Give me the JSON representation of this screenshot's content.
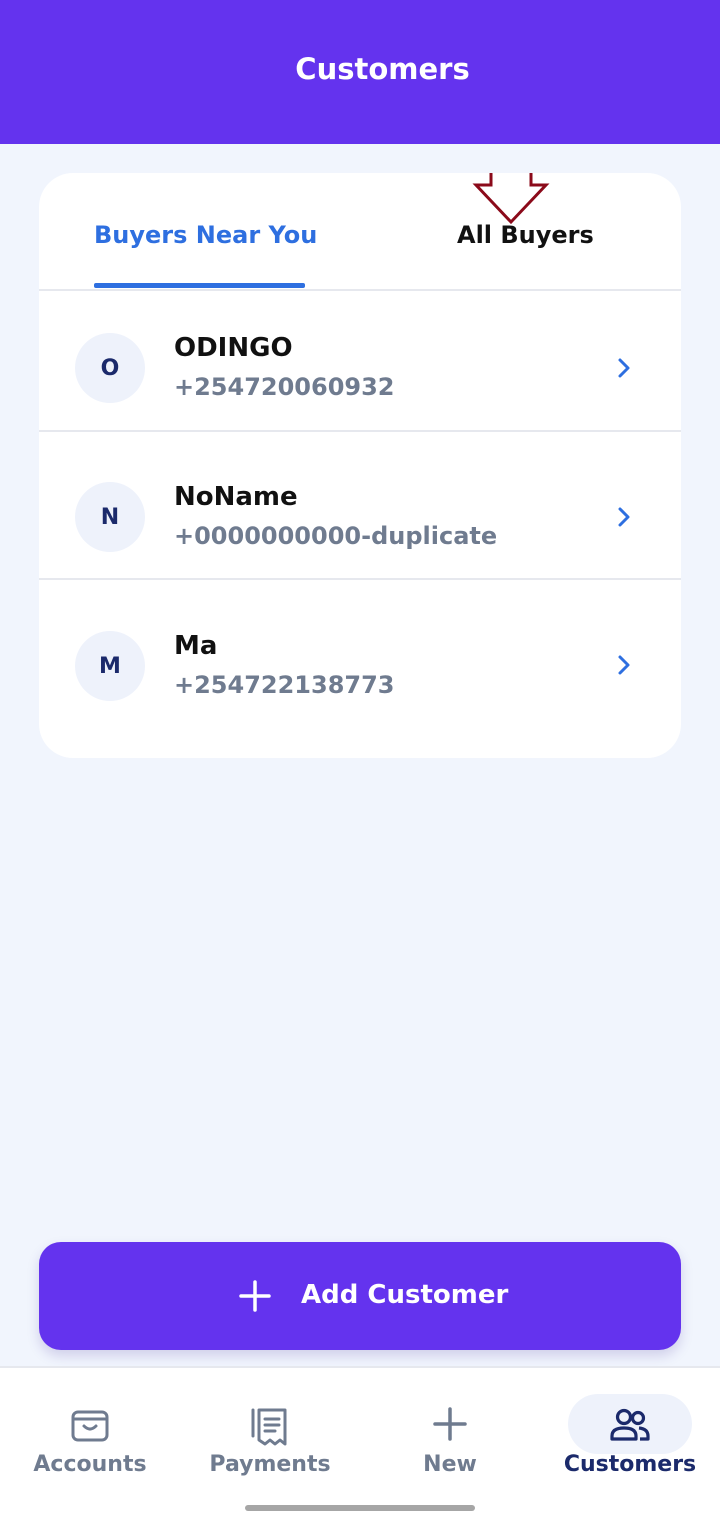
{
  "header": {
    "title": "Customers"
  },
  "tabs": [
    {
      "label": "Buyers Near You",
      "active": true
    },
    {
      "label": "All Buyers",
      "active": false
    }
  ],
  "customers": [
    {
      "initial": "O",
      "name": "ODINGO",
      "phone": "+254720060932"
    },
    {
      "initial": "N",
      "name": "NoName",
      "phone": "+0000000000-duplicate"
    },
    {
      "initial": "M",
      "name": "Ma",
      "phone": "+254722138773"
    }
  ],
  "add_button": {
    "label": "Add Customer",
    "icon": "plus-icon"
  },
  "bottom_nav": [
    {
      "label": "Accounts",
      "icon": "wallet-icon",
      "active": false
    },
    {
      "label": "Payments",
      "icon": "receipt-icon",
      "active": false
    },
    {
      "label": "New",
      "icon": "plus-icon",
      "active": false
    },
    {
      "label": "Customers",
      "icon": "users-icon",
      "active": true
    }
  ],
  "colors": {
    "brand": "#6433ee",
    "accent": "#2e6fe0",
    "annotation_arrow": "#8b0a1a",
    "nav_active": "#1b2a6b"
  }
}
